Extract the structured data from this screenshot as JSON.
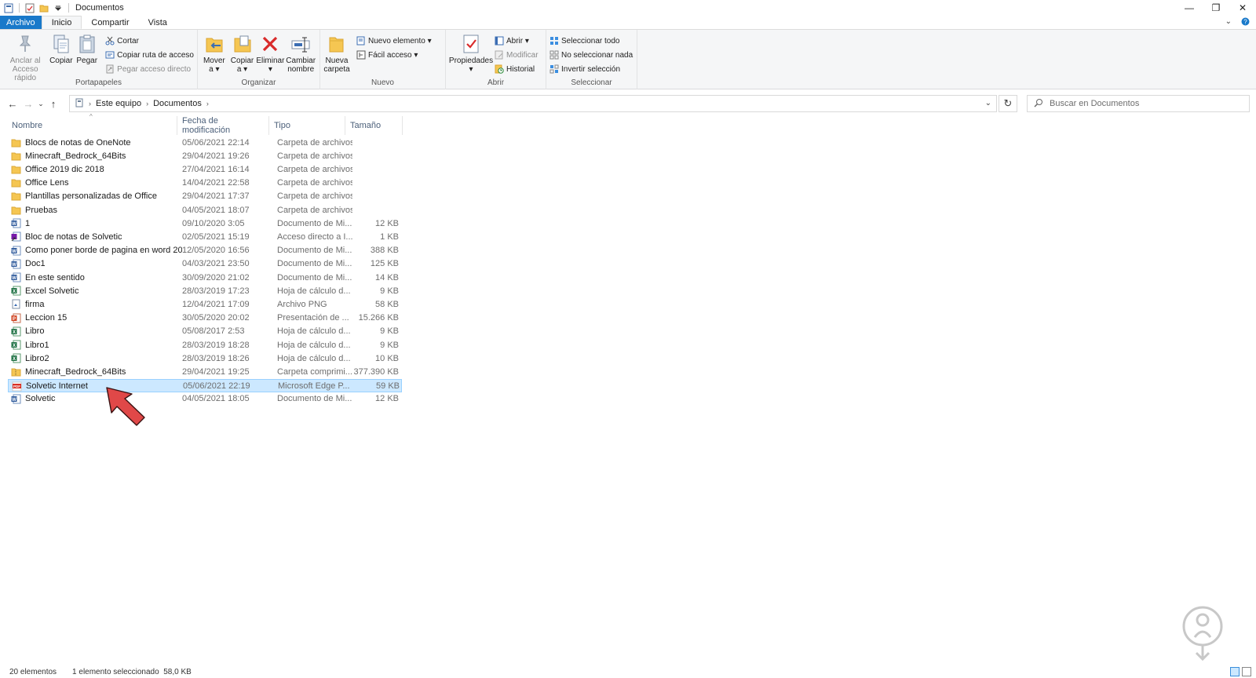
{
  "window": {
    "title": "Documentos",
    "minimize": "—",
    "restore": "❐",
    "close": "✕"
  },
  "ribbon_tabs": [
    "Archivo",
    "Inicio",
    "Compartir",
    "Vista"
  ],
  "ribbon": {
    "portapapeles": {
      "label": "Portapapeles",
      "pin": "Anclar al\nAcceso rápido",
      "copy": "Copiar",
      "paste": "Pegar",
      "cut": "Cortar",
      "copy_path": "Copiar ruta de acceso",
      "paste_shortcut": "Pegar acceso directo"
    },
    "organizar": {
      "label": "Organizar",
      "move": "Mover\na ▾",
      "copy_to": "Copiar\na ▾",
      "delete": "Eliminar\n▾",
      "rename": "Cambiar\nnombre"
    },
    "nuevo": {
      "label": "Nuevo",
      "new_folder": "Nueva\ncarpeta",
      "new_item": "Nuevo elemento ▾",
      "easy_access": "Fácil acceso ▾"
    },
    "abrir": {
      "label": "Abrir",
      "properties": "Propiedades\n▾",
      "open": "Abrir ▾",
      "edit": "Modificar",
      "history": "Historial"
    },
    "seleccionar": {
      "label": "Seleccionar",
      "select_all": "Seleccionar todo",
      "select_none": "No seleccionar nada",
      "invert": "Invertir selección"
    }
  },
  "address": {
    "crumbs": [
      "Este equipo",
      "Documentos"
    ],
    "search_placeholder": "Buscar en Documentos"
  },
  "columns": {
    "name": "Nombre",
    "date": "Fecha de modificación",
    "type": "Tipo",
    "size": "Tamaño"
  },
  "files": [
    {
      "name": "Blocs de notas de OneNote",
      "date": "05/06/2021 22:14",
      "type": "Carpeta de archivos",
      "size": "",
      "icon": "folder"
    },
    {
      "name": "Minecraft_Bedrock_64Bits",
      "date": "29/04/2021 19:26",
      "type": "Carpeta de archivos",
      "size": "",
      "icon": "folder"
    },
    {
      "name": "Office 2019 dic 2018",
      "date": "27/04/2021 16:14",
      "type": "Carpeta de archivos",
      "size": "",
      "icon": "folder"
    },
    {
      "name": "Office Lens",
      "date": "14/04/2021 22:58",
      "type": "Carpeta de archivos",
      "size": "",
      "icon": "folder"
    },
    {
      "name": "Plantillas personalizadas de Office",
      "date": "29/04/2021 17:37",
      "type": "Carpeta de archivos",
      "size": "",
      "icon": "folder"
    },
    {
      "name": "Pruebas",
      "date": "04/05/2021 18:07",
      "type": "Carpeta de archivos",
      "size": "",
      "icon": "folder"
    },
    {
      "name": "1",
      "date": "09/10/2020 3:05",
      "type": "Documento de Mi...",
      "size": "12 KB",
      "icon": "word"
    },
    {
      "name": "Bloc de notas de Solvetic",
      "date": "02/05/2021 15:19",
      "type": "Acceso directo a I...",
      "size": "1 KB",
      "icon": "shortcut"
    },
    {
      "name": "Como poner borde de pagina en word 20...",
      "date": "12/05/2020 16:56",
      "type": "Documento de Mi...",
      "size": "388 KB",
      "icon": "word"
    },
    {
      "name": "Doc1",
      "date": "04/03/2021 23:50",
      "type": "Documento de Mi...",
      "size": "125 KB",
      "icon": "word"
    },
    {
      "name": "En este sentido",
      "date": "30/09/2020 21:02",
      "type": "Documento de Mi...",
      "size": "14 KB",
      "icon": "word"
    },
    {
      "name": "Excel Solvetic",
      "date": "28/03/2019 17:23",
      "type": "Hoja de cálculo d...",
      "size": "9 KB",
      "icon": "excel"
    },
    {
      "name": "firma",
      "date": "12/04/2021 17:09",
      "type": "Archivo PNG",
      "size": "58 KB",
      "icon": "image"
    },
    {
      "name": "Leccion 15",
      "date": "30/05/2020 20:02",
      "type": "Presentación de ...",
      "size": "15.266 KB",
      "icon": "powerpoint"
    },
    {
      "name": "Libro",
      "date": "05/08/2017 2:53",
      "type": "Hoja de cálculo d...",
      "size": "9 KB",
      "icon": "excel"
    },
    {
      "name": "Libro1",
      "date": "28/03/2019 18:28",
      "type": "Hoja de cálculo d...",
      "size": "9 KB",
      "icon": "excel"
    },
    {
      "name": "Libro2",
      "date": "28/03/2019 18:26",
      "type": "Hoja de cálculo d...",
      "size": "10 KB",
      "icon": "excel"
    },
    {
      "name": "Minecraft_Bedrock_64Bits",
      "date": "29/04/2021 19:25",
      "type": "Carpeta comprimi...",
      "size": "377.390 KB",
      "icon": "zip"
    },
    {
      "name": "Solvetic Internet",
      "date": "05/06/2021 22:19",
      "type": "Microsoft Edge P...",
      "size": "59 KB",
      "icon": "pdf",
      "selected": true
    },
    {
      "name": "Solvetic",
      "date": "04/05/2021 18:05",
      "type": "Documento de Mi...",
      "size": "12 KB",
      "icon": "word"
    }
  ],
  "status": {
    "count": "20 elementos",
    "selection": "1 elemento seleccionado  58,0 KB"
  },
  "colors": {
    "accent": "#1979ca",
    "selection": "#cce8ff",
    "arrow": "#e04848"
  }
}
